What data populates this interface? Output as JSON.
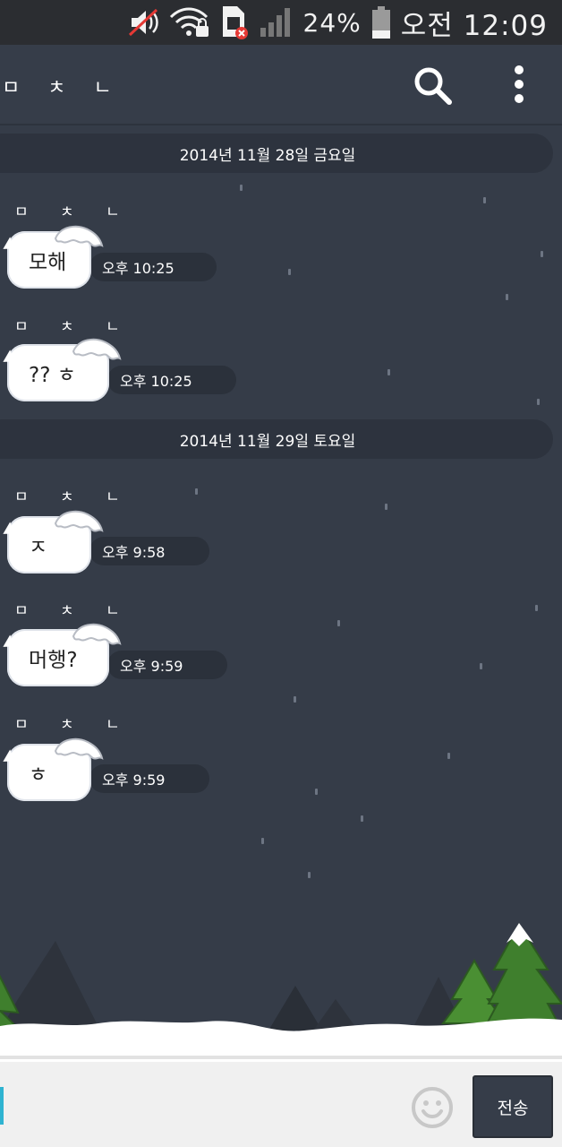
{
  "status_bar": {
    "battery": "24%",
    "time": "오전 12:09",
    "icons": [
      "mute-icon",
      "wifi-lock-icon",
      "sim-error-icon",
      "signal-icon",
      "battery-icon"
    ]
  },
  "app_bar": {
    "title": "ㅁ ㅊ ㄴ",
    "icons": [
      "search-icon",
      "more-vertical-icon"
    ]
  },
  "chat": {
    "dates": [
      "2014년 11월 28일 금요일",
      "2014년 11월 29일 토요일"
    ],
    "messages": [
      {
        "sender": "ㅁ ㅊ ㄴ",
        "text": "모해",
        "time": "오후 10:25"
      },
      {
        "sender": "ㅁ ㅊ ㄴ",
        "text": "?? ㅎ",
        "time": "오후 10:25"
      },
      {
        "sender": "ㅁ ㅊ ㄴ",
        "text": "ㅈ",
        "time": "오후 9:58"
      },
      {
        "sender": "ㅁ ㅊ ㄴ",
        "text": "머행?",
        "time": "오후 9:59"
      },
      {
        "sender": "ㅁ ㅊ ㄴ",
        "text": "ㅎ",
        "time": "오후 9:59"
      }
    ]
  },
  "input_bar": {
    "value": "",
    "send_label": "전송",
    "icons": [
      "emoji-icon"
    ]
  },
  "colors": {
    "background": "#353c48",
    "status_bar": "#2b2d31",
    "pill": "#2d333e",
    "bubble": "#ffffff",
    "input_bar": "#f0f0f0",
    "cursor": "#2fb3d1",
    "tree": "#3f7f2d"
  }
}
